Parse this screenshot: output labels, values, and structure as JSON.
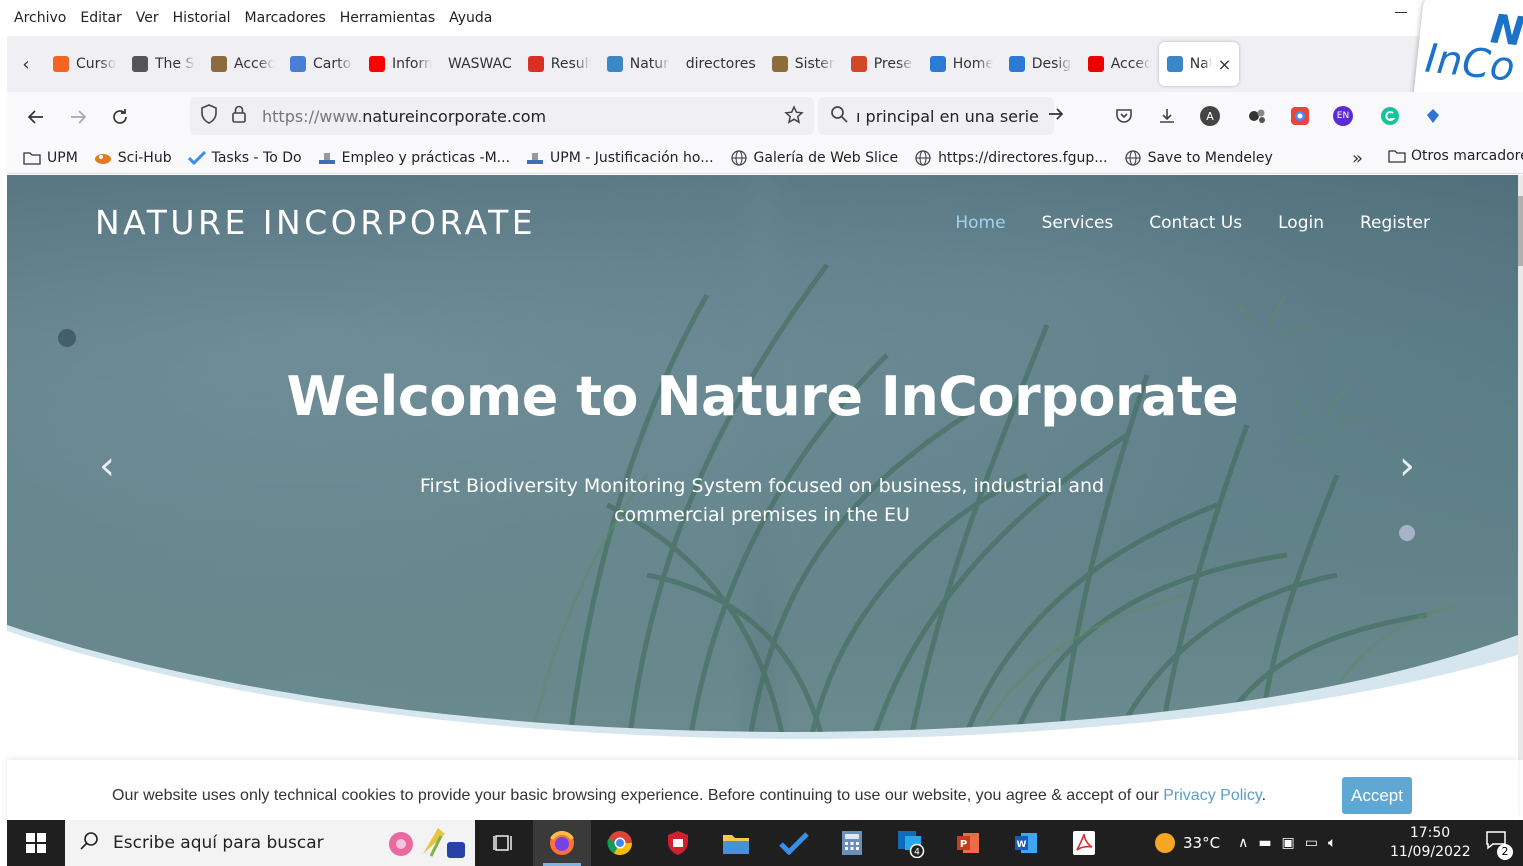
{
  "menu": [
    "Archivo",
    "Editar",
    "Ver",
    "Historial",
    "Marcadores",
    "Herramientas",
    "Ayuda"
  ],
  "tabs": [
    {
      "label": "Curso",
      "icon": "orange-e-icon",
      "color": "#f26522"
    },
    {
      "label": "The St",
      "icon": "the-st-icon",
      "color": "#555555"
    },
    {
      "label": "Acced",
      "icon": "crest-icon",
      "color": "#8a6d3b"
    },
    {
      "label": "Carto",
      "icon": "globe-icon",
      "color": "#4a7fd6"
    },
    {
      "label": "Inform",
      "icon": "youtube-icon",
      "color": "#ff0000"
    },
    {
      "label": "WASWAC",
      "icon": "",
      "color": ""
    },
    {
      "label": "Result",
      "icon": "gmail-icon",
      "color": "#d93025"
    },
    {
      "label": "Natur",
      "icon": "bars-icon",
      "color": "#3b86c4"
    },
    {
      "label": "directores",
      "icon": "",
      "color": ""
    },
    {
      "label": "Sisten",
      "icon": "crest-icon",
      "color": "#8a6d3b"
    },
    {
      "label": "Preser",
      "icon": "powerpoint-icon",
      "color": "#d24726"
    },
    {
      "label": "Home",
      "icon": "canva-icon",
      "color": "#2b7bd6"
    },
    {
      "label": "Desig",
      "icon": "canva-icon",
      "color": "#2b7bd6"
    },
    {
      "label": "Acced",
      "icon": "santander-icon",
      "color": "#ec0000"
    },
    {
      "label": "Nat",
      "icon": "bars-icon",
      "color": "#3b86c4"
    }
  ],
  "corner_logo": {
    "line1": "Na",
    "line2": "InCo"
  },
  "address": {
    "prefix": "https://www.",
    "domain": "natureincorporate.com"
  },
  "search": {
    "text": "ı principal en una serie"
  },
  "bookmarks": [
    {
      "label": "UPM",
      "icon": "folder-icon"
    },
    {
      "label": "Sci-Hub",
      "icon": "sci-hub-icon"
    },
    {
      "label": "Tasks - To Do",
      "icon": "todo-check-icon"
    },
    {
      "label": "Empleo y prácticas -M...",
      "icon": "upm-icon"
    },
    {
      "label": "UPM - Justificación ho...",
      "icon": "upm-icon"
    },
    {
      "label": "Galería de Web Slice",
      "icon": "globe-icon"
    },
    {
      "label": "https://directores.fgup...",
      "icon": "globe-icon"
    },
    {
      "label": "Save to Mendeley",
      "icon": "globe-icon"
    }
  ],
  "bookmarks_other": "Otros marcadores",
  "site": {
    "brand": "NATURE INCORPORATE",
    "nav": [
      "Home",
      "Services",
      "Contact Us",
      "Login",
      "Register"
    ],
    "headline": "Welcome to Nature InCorporate",
    "subline": "First Biodiversity Monitoring System focused on business, industrial and commercial premises in the EU",
    "prev": "‹",
    "next": "›"
  },
  "cookie": {
    "text": "Our website uses only technical cookies to provide your basic browsing experience. Before continuing to use our website, you agree & accept of our ",
    "link": "Privacy Policy",
    "after": ".",
    "accept": "Accept"
  },
  "taskbar": {
    "search_placeholder": "Escribe aquí para buscar",
    "weather": "33°C",
    "time": "17:50",
    "date": "11/09/2022",
    "notif_count": "2",
    "outlook_badge": "4"
  },
  "colors": {
    "accent": "#5fa8d3",
    "nav_active": "#9fd3f0",
    "link": "#5b9fc7"
  }
}
